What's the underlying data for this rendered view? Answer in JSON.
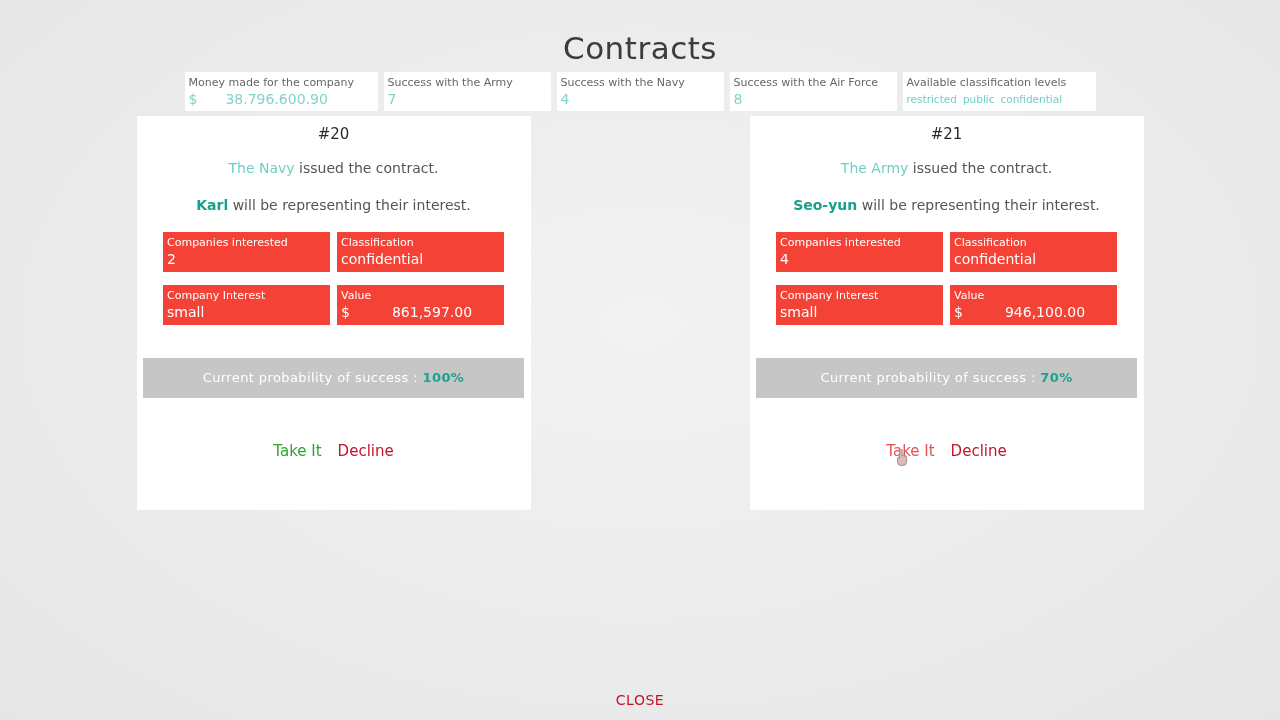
{
  "title": "Contracts",
  "stats": [
    {
      "kind": "money",
      "label": "Money made for the company",
      "currency": "$",
      "value": "38.796.600.90"
    },
    {
      "kind": "count",
      "label": "Success with the Army",
      "value": "7"
    },
    {
      "kind": "count",
      "label": "Success with the Navy",
      "value": "4"
    },
    {
      "kind": "count",
      "label": "Success with the Air Force",
      "value": "8"
    },
    {
      "kind": "levels",
      "label": "Available classification levels",
      "values": [
        "restricted",
        "public",
        "confidential"
      ]
    }
  ],
  "contracts": [
    {
      "number": "#20",
      "issuer": "The Navy",
      "issued_text": "issued the contract.",
      "representative": "Karl",
      "representing_text": "will be representing their interest.",
      "details": [
        {
          "label": "Companies interested",
          "value": "2"
        },
        {
          "label": "Classification",
          "value": "confidential"
        },
        {
          "label": "Company Interest",
          "value": "small"
        },
        {
          "label": "Value",
          "currency": "$",
          "value": "861,597.00"
        }
      ],
      "probability_label": "Current probability of success :",
      "probability": "100%",
      "actions": [
        {
          "kind": "accept",
          "label": "Take It",
          "hovered": false
        },
        {
          "kind": "decline",
          "label": "Decline",
          "hovered": false
        }
      ]
    },
    {
      "number": "#21",
      "issuer": "The Army",
      "issued_text": "issued the contract.",
      "representative": "Seo-yun",
      "representing_text": "will be representing their interest.",
      "details": [
        {
          "label": "Companies interested",
          "value": "4"
        },
        {
          "label": "Classification",
          "value": "confidential"
        },
        {
          "label": "Company Interest",
          "value": "small"
        },
        {
          "label": "Value",
          "currency": "$",
          "value": "946,100.00"
        }
      ],
      "probability_label": "Current probability of success :",
      "probability": "70%",
      "actions": [
        {
          "kind": "accept",
          "label": "Take It",
          "hovered": true
        },
        {
          "kind": "decline",
          "label": "Decline",
          "hovered": false
        }
      ]
    }
  ],
  "close_button": "CLOSE"
}
